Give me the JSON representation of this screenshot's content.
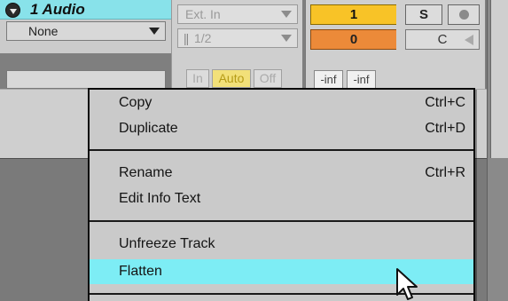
{
  "track": {
    "name": "1 Audio",
    "input_routing": "None",
    "input_type": "Ext. In",
    "input_channel": "1/2",
    "monitor": {
      "in": "In",
      "auto": "Auto",
      "off": "Off"
    }
  },
  "mixer": {
    "track_number": "1",
    "solo": "S",
    "arm_icon": "record-dot-icon",
    "volume": "0",
    "pan": "C",
    "meter_left": "-inf",
    "meter_right": "-inf"
  },
  "context_menu": {
    "items": [
      {
        "label": "Copy",
        "shortcut": "Ctrl+C"
      },
      {
        "label": "Duplicate",
        "shortcut": "Ctrl+D"
      },
      {
        "label": "Rename",
        "shortcut": "Ctrl+R"
      },
      {
        "label": "Edit Info Text",
        "shortcut": ""
      },
      {
        "label": "Unfreeze Track",
        "shortcut": ""
      },
      {
        "label": "Flatten",
        "shortcut": ""
      }
    ],
    "highlighted": "Flatten"
  },
  "colors": {
    "track_title": "#88e2ea",
    "highlight": "#7dedf5",
    "track_number_bg": "#f8c327",
    "volume_bg": "#ec8a39"
  },
  "cursor_icon": "arrow-pointer-icon"
}
